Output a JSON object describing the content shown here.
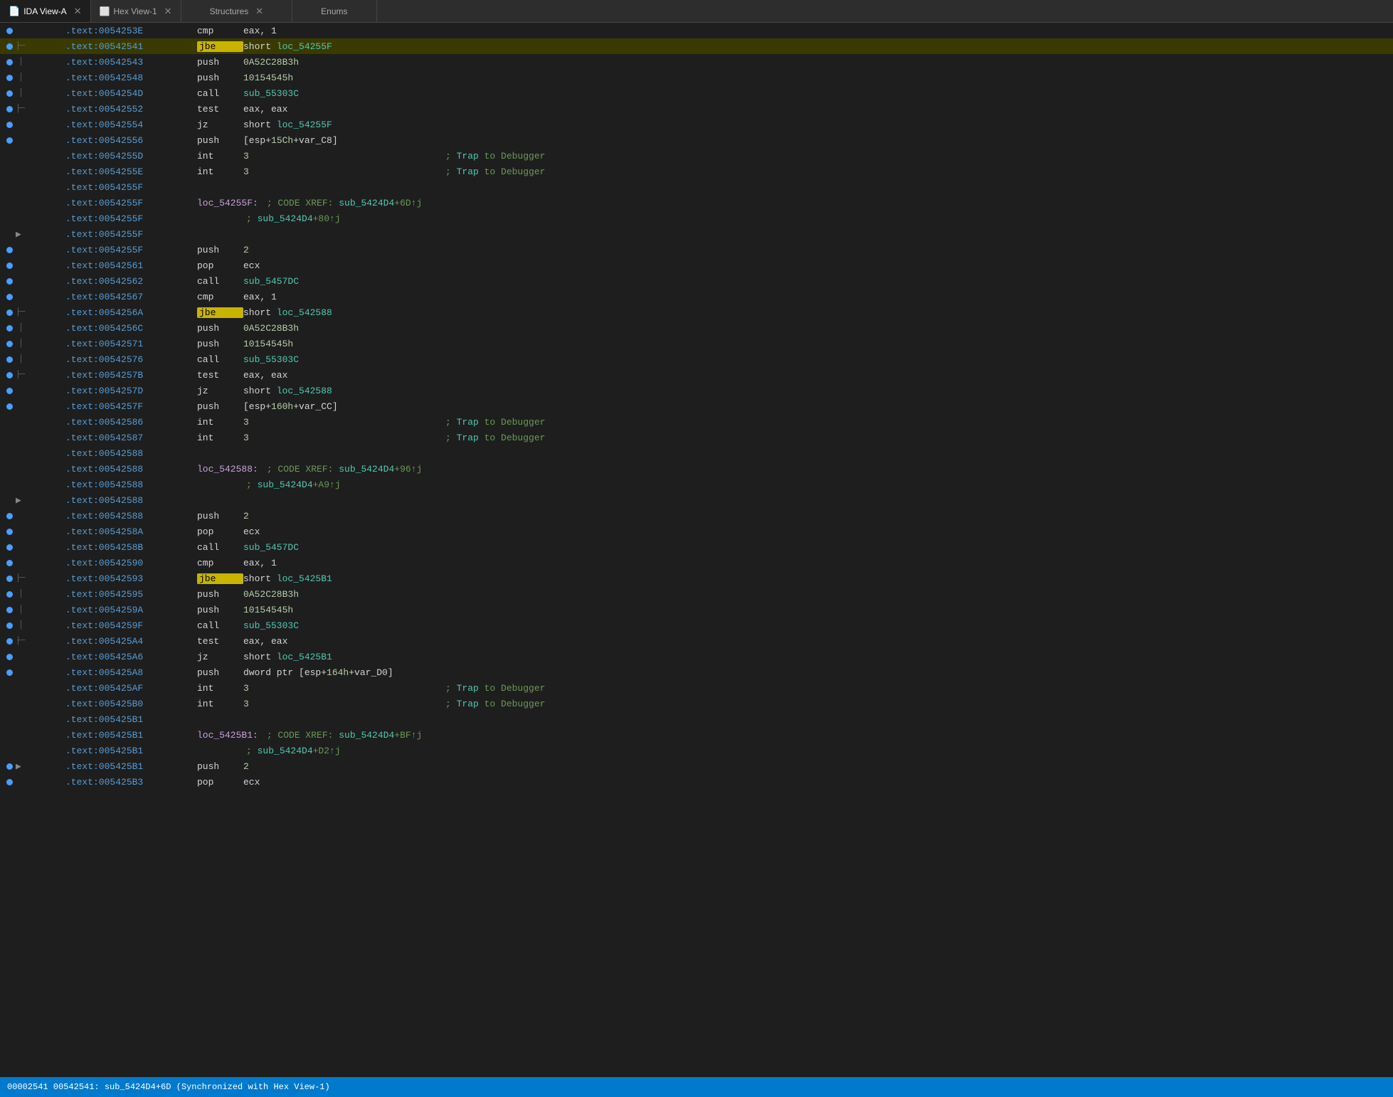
{
  "tabs": [
    {
      "id": "ida-view",
      "label": "IDA View-A",
      "icon": "📄",
      "active": true
    },
    {
      "id": "hex-view",
      "label": "Hex View-1",
      "icon": "⬜",
      "active": false
    },
    {
      "id": "structures",
      "label": "Structures",
      "icon": "A",
      "active": false
    },
    {
      "id": "enums",
      "label": "Enums",
      "icon": "⬛",
      "active": false
    }
  ],
  "status_bar": "00002541 00542541: sub_5424D4+6D (Synchronized with Hex View-1)",
  "lines": [
    {
      "addr": ".text:0054253E",
      "label": "",
      "mnemonic": "cmp",
      "mnemonic_type": "normal",
      "operand": "eax, 1",
      "comment": "",
      "dot": true,
      "branch": ""
    },
    {
      "addr": ".text:00542541",
      "label": "",
      "mnemonic": "jbe",
      "mnemonic_type": "jbe",
      "operand": "short loc_54255F",
      "comment": "",
      "dot": true,
      "branch": "branch-start",
      "highlighted": true
    },
    {
      "addr": ".text:00542543",
      "label": "",
      "mnemonic": "push",
      "mnemonic_type": "normal",
      "operand": "0A52C28B3h",
      "comment": "",
      "dot": true,
      "branch": "branch-line"
    },
    {
      "addr": ".text:00542548",
      "label": "",
      "mnemonic": "push",
      "mnemonic_type": "normal",
      "operand": "10154545h",
      "comment": "",
      "dot": true,
      "branch": "branch-line"
    },
    {
      "addr": ".text:0054254D",
      "label": "",
      "mnemonic": "call",
      "mnemonic_type": "normal",
      "operand": "sub_55303C",
      "comment": "",
      "dot": true,
      "branch": "branch-line"
    },
    {
      "addr": ".text:00542552",
      "label": "",
      "mnemonic": "test",
      "mnemonic_type": "normal",
      "operand": "eax, eax",
      "comment": "",
      "dot": true,
      "branch": "branch-end-jz"
    },
    {
      "addr": ".text:00542554",
      "label": "",
      "mnemonic": "jz",
      "mnemonic_type": "normal",
      "operand": "short loc_54255F",
      "comment": "",
      "dot": true,
      "branch": ""
    },
    {
      "addr": ".text:00542556",
      "label": "",
      "mnemonic": "push",
      "mnemonic_type": "normal",
      "operand": "[esp+15Ch+var_C8]",
      "comment": "",
      "dot": true,
      "branch": ""
    },
    {
      "addr": ".text:0054255D",
      "label": "",
      "mnemonic": "int",
      "mnemonic_type": "normal",
      "operand": "3",
      "comment": "; Trap to Debugger",
      "dot": false,
      "branch": ""
    },
    {
      "addr": ".text:0054255E",
      "label": "",
      "mnemonic": "int",
      "mnemonic_type": "normal",
      "operand": "3",
      "comment": "; Trap to Debugger",
      "dot": false,
      "branch": ""
    },
    {
      "addr": ".text:0054255F",
      "label": "",
      "mnemonic": "",
      "mnemonic_type": "normal",
      "operand": "",
      "comment": "",
      "dot": false,
      "branch": "",
      "empty": true
    },
    {
      "addr": ".text:0054255F",
      "label": "loc_54255F:",
      "mnemonic": "",
      "mnemonic_type": "normal",
      "operand": "",
      "comment": "; CODE XREF: sub_5424D4+6D↑j",
      "dot": false,
      "branch": ""
    },
    {
      "addr": ".text:0054255F",
      "label": "",
      "mnemonic": "",
      "mnemonic_type": "normal",
      "operand": "",
      "comment": "; sub_5424D4+80↑j",
      "dot": false,
      "branch": ""
    },
    {
      "addr": ".text:0054255F",
      "label": "",
      "mnemonic": "",
      "mnemonic_type": "normal",
      "operand": "",
      "comment": "",
      "dot": false,
      "branch": "arrow-down",
      "empty": true
    },
    {
      "addr": ".text:0054255F",
      "label": "",
      "mnemonic": "push",
      "mnemonic_type": "normal",
      "operand": "2",
      "comment": "",
      "dot": true,
      "branch": ""
    },
    {
      "addr": ".text:00542561",
      "label": "",
      "mnemonic": "pop",
      "mnemonic_type": "normal",
      "operand": "ecx",
      "comment": "",
      "dot": true,
      "branch": ""
    },
    {
      "addr": ".text:00542562",
      "label": "",
      "mnemonic": "call",
      "mnemonic_type": "normal",
      "operand": "sub_5457DC",
      "comment": "",
      "dot": true,
      "branch": ""
    },
    {
      "addr": ".text:00542567",
      "label": "",
      "mnemonic": "cmp",
      "mnemonic_type": "normal",
      "operand": "eax, 1",
      "comment": "",
      "dot": true,
      "branch": ""
    },
    {
      "addr": ".text:0054256A",
      "label": "",
      "mnemonic": "jbe",
      "mnemonic_type": "jbe",
      "operand": "short loc_542588",
      "comment": "",
      "dot": true,
      "branch": "branch-start2"
    },
    {
      "addr": ".text:0054256C",
      "label": "",
      "mnemonic": "push",
      "mnemonic_type": "normal",
      "operand": "0A52C28B3h",
      "comment": "",
      "dot": true,
      "branch": "branch-line2"
    },
    {
      "addr": ".text:00542571",
      "label": "",
      "mnemonic": "push",
      "mnemonic_type": "normal",
      "operand": "10154545h",
      "comment": "",
      "dot": true,
      "branch": "branch-line2"
    },
    {
      "addr": ".text:00542576",
      "label": "",
      "mnemonic": "call",
      "mnemonic_type": "normal",
      "operand": "sub_55303C",
      "comment": "",
      "dot": true,
      "branch": "branch-line2"
    },
    {
      "addr": ".text:0054257B",
      "label": "",
      "mnemonic": "test",
      "mnemonic_type": "normal",
      "operand": "eax, eax",
      "comment": "",
      "dot": true,
      "branch": "branch-end-jz2"
    },
    {
      "addr": ".text:0054257D",
      "label": "",
      "mnemonic": "jz",
      "mnemonic_type": "normal",
      "operand": "short loc_542588",
      "comment": "",
      "dot": true,
      "branch": ""
    },
    {
      "addr": ".text:0054257F",
      "label": "",
      "mnemonic": "push",
      "mnemonic_type": "normal",
      "operand": "[esp+160h+var_CC]",
      "comment": "",
      "dot": true,
      "branch": ""
    },
    {
      "addr": ".text:00542586",
      "label": "",
      "mnemonic": "int",
      "mnemonic_type": "normal",
      "operand": "3",
      "comment": "; Trap to Debugger",
      "dot": false,
      "branch": ""
    },
    {
      "addr": ".text:00542587",
      "label": "",
      "mnemonic": "int",
      "mnemonic_type": "normal",
      "operand": "3",
      "comment": "; Trap to Debugger",
      "dot": false,
      "branch": ""
    },
    {
      "addr": ".text:00542588",
      "label": "",
      "mnemonic": "",
      "mnemonic_type": "normal",
      "operand": "",
      "comment": "",
      "dot": false,
      "branch": "",
      "empty": true
    },
    {
      "addr": ".text:00542588",
      "label": "loc_542588:",
      "mnemonic": "",
      "mnemonic_type": "normal",
      "operand": "",
      "comment": "; CODE XREF: sub_5424D4+96↑j",
      "dot": false,
      "branch": ""
    },
    {
      "addr": ".text:00542588",
      "label": "",
      "mnemonic": "",
      "mnemonic_type": "normal",
      "operand": "",
      "comment": "; sub_5424D4+A9↑j",
      "dot": false,
      "branch": ""
    },
    {
      "addr": ".text:00542588",
      "label": "",
      "mnemonic": "",
      "mnemonic_type": "normal",
      "operand": "",
      "comment": "",
      "dot": false,
      "branch": "arrow-down2",
      "empty": true
    },
    {
      "addr": ".text:00542588",
      "label": "",
      "mnemonic": "push",
      "mnemonic_type": "normal",
      "operand": "2",
      "comment": "",
      "dot": true,
      "branch": ""
    },
    {
      "addr": ".text:0054258A",
      "label": "",
      "mnemonic": "pop",
      "mnemonic_type": "normal",
      "operand": "ecx",
      "comment": "",
      "dot": true,
      "branch": ""
    },
    {
      "addr": ".text:0054258B",
      "label": "",
      "mnemonic": "call",
      "mnemonic_type": "normal",
      "operand": "sub_5457DC",
      "comment": "",
      "dot": true,
      "branch": ""
    },
    {
      "addr": ".text:00542590",
      "label": "",
      "mnemonic": "cmp",
      "mnemonic_type": "normal",
      "operand": "eax, 1",
      "comment": "",
      "dot": true,
      "branch": ""
    },
    {
      "addr": ".text:00542593",
      "label": "",
      "mnemonic": "jbe",
      "mnemonic_type": "jbe",
      "operand": "short loc_5425B1",
      "comment": "",
      "dot": true,
      "branch": "branch-start3"
    },
    {
      "addr": ".text:00542595",
      "label": "",
      "mnemonic": "push",
      "mnemonic_type": "normal",
      "operand": "0A52C28B3h",
      "comment": "",
      "dot": true,
      "branch": "branch-line3"
    },
    {
      "addr": ".text:0054259A",
      "label": "",
      "mnemonic": "push",
      "mnemonic_type": "normal",
      "operand": "10154545h",
      "comment": "",
      "dot": true,
      "branch": "branch-line3"
    },
    {
      "addr": ".text:0054259F",
      "label": "",
      "mnemonic": "call",
      "mnemonic_type": "normal",
      "operand": "sub_55303C",
      "comment": "",
      "dot": true,
      "branch": "branch-line3"
    },
    {
      "addr": ".text:005425A4",
      "label": "",
      "mnemonic": "test",
      "mnemonic_type": "normal",
      "operand": "eax, eax",
      "comment": "",
      "dot": true,
      "branch": "branch-end-jz3"
    },
    {
      "addr": ".text:005425A6",
      "label": "",
      "mnemonic": "jz",
      "mnemonic_type": "normal",
      "operand": "short loc_5425B1",
      "comment": "",
      "dot": true,
      "branch": ""
    },
    {
      "addr": ".text:005425A8",
      "label": "",
      "mnemonic": "push",
      "mnemonic_type": "normal",
      "operand": "dword ptr [esp+164h+var_D0]",
      "comment": "",
      "dot": true,
      "branch": ""
    },
    {
      "addr": ".text:005425AF",
      "label": "",
      "mnemonic": "int",
      "mnemonic_type": "normal",
      "operand": "3",
      "comment": "; Trap to Debugger",
      "dot": false,
      "branch": ""
    },
    {
      "addr": ".text:005425B0",
      "label": "",
      "mnemonic": "int",
      "mnemonic_type": "normal",
      "operand": "3",
      "comment": "; Trap to Debugger",
      "dot": false,
      "branch": ""
    },
    {
      "addr": ".text:005425B1",
      "label": "",
      "mnemonic": "",
      "mnemonic_type": "normal",
      "operand": "",
      "comment": "",
      "dot": false,
      "branch": "",
      "empty": true
    },
    {
      "addr": ".text:005425B1",
      "label": "loc_5425B1:",
      "mnemonic": "",
      "mnemonic_type": "normal",
      "operand": "",
      "comment": "; CODE XREF: sub_5424D4+BF↑j",
      "dot": false,
      "branch": ""
    },
    {
      "addr": ".text:005425B1",
      "label": "",
      "mnemonic": "",
      "mnemonic_type": "normal",
      "operand": "",
      "comment": "; sub_5424D4+D2↑j",
      "dot": false,
      "branch": ""
    },
    {
      "addr": ".text:005425B1",
      "label": "",
      "mnemonic": "push",
      "mnemonic_type": "normal",
      "operand": "2",
      "comment": "",
      "dot": true,
      "branch": "arrow-down3"
    },
    {
      "addr": ".text:005425B3",
      "label": "",
      "mnemonic": "pop",
      "mnemonic_type": "normal",
      "operand": "ecx",
      "comment": "",
      "dot": true,
      "branch": ""
    }
  ]
}
